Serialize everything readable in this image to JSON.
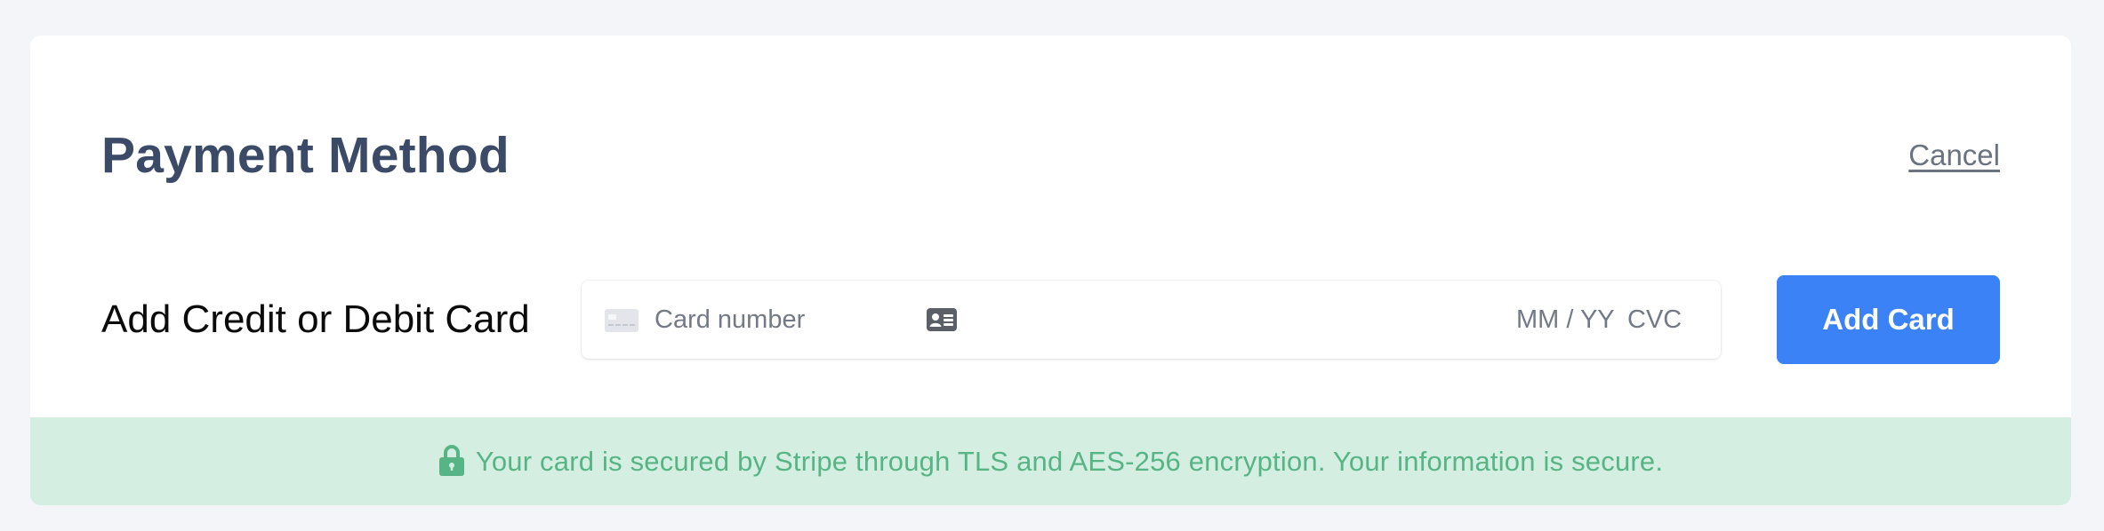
{
  "header": {
    "title": "Payment Method",
    "cancel_label": "Cancel"
  },
  "card_form": {
    "label": "Add Credit or Debit Card",
    "card_number_placeholder": "Card number",
    "expiry_placeholder": "MM / YY",
    "cvc_placeholder": "CVC",
    "submit_label": "Add Card"
  },
  "security_notice": {
    "text": "Your card is secured by Stripe through TLS and AES-256 encryption. Your information is secure.",
    "icon": "lock-icon"
  },
  "colors": {
    "title": "#3b4a66",
    "accent": "#3b82f6",
    "notice_bg": "#d4eee2",
    "notice_text": "#57b585"
  }
}
